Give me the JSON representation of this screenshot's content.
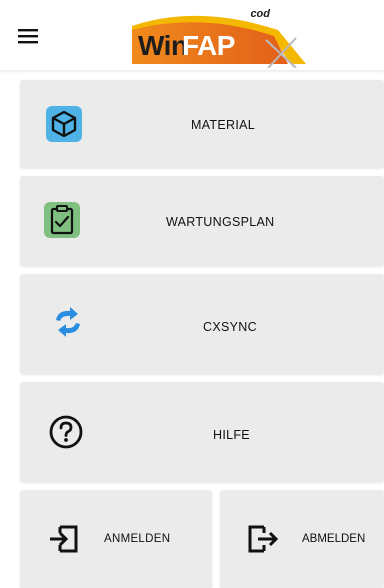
{
  "header": {
    "logo": {
      "brand_prefix": "Win",
      "brand_suffix": "FAP",
      "company_mark": "cod"
    },
    "menu_icon": "hamburger-menu-icon"
  },
  "menu": {
    "items": [
      {
        "label": "MATERIAL",
        "icon": "cube-icon",
        "icon_bg": "#4fb3e8"
      },
      {
        "label": "WARTUNGSPLAN",
        "icon": "clipboard-check-icon",
        "icon_bg": "#7fbf7f"
      },
      {
        "label": "CXSYNC",
        "icon": "sync-arrows-icon",
        "icon_color": "#2a8fe0"
      },
      {
        "label": "HILFE",
        "icon": "help-circle-icon"
      }
    ],
    "bottom_buttons": [
      {
        "label": "ANMELDEN",
        "icon": "login-icon"
      },
      {
        "label": "ABMELDEN",
        "icon": "logout-icon"
      }
    ]
  },
  "colors": {
    "tile_bg": "#ebebeb",
    "logo_orange": "#e8731f",
    "logo_yellow": "#f5b800"
  }
}
